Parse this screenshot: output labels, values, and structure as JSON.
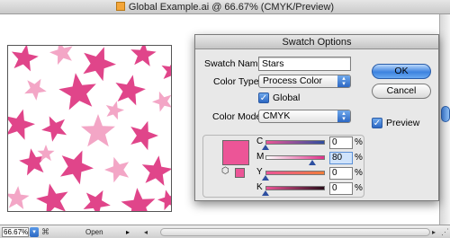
{
  "window": {
    "title": "Global Example.ai @ 66.67% (CMYK/Preview)"
  },
  "statusbar": {
    "zoom": "66.67%",
    "status_text": "Open"
  },
  "artwork": {
    "background": "#ffffff",
    "star_colors": [
      "#e0458a",
      "#f3a6c6"
    ]
  },
  "dialog": {
    "title": "Swatch Options",
    "swatch_name_label": "Swatch Name:",
    "swatch_name_value": "Stars",
    "color_type_label": "Color Type:",
    "color_type_value": "Process Color",
    "global_label": "Global",
    "global_checked": true,
    "color_mode_label": "Color Mode:",
    "color_mode_value": "CMYK",
    "preview_label": "Preview",
    "preview_checked": true,
    "ok_label": "OK",
    "cancel_label": "Cancel",
    "swatch_color": "#ec5597",
    "sliders": [
      {
        "letter": "C",
        "value": "0",
        "unit": "%"
      },
      {
        "letter": "M",
        "value": "80",
        "unit": "%"
      },
      {
        "letter": "Y",
        "value": "0",
        "unit": "%"
      },
      {
        "letter": "K",
        "value": "0",
        "unit": "%"
      }
    ]
  }
}
